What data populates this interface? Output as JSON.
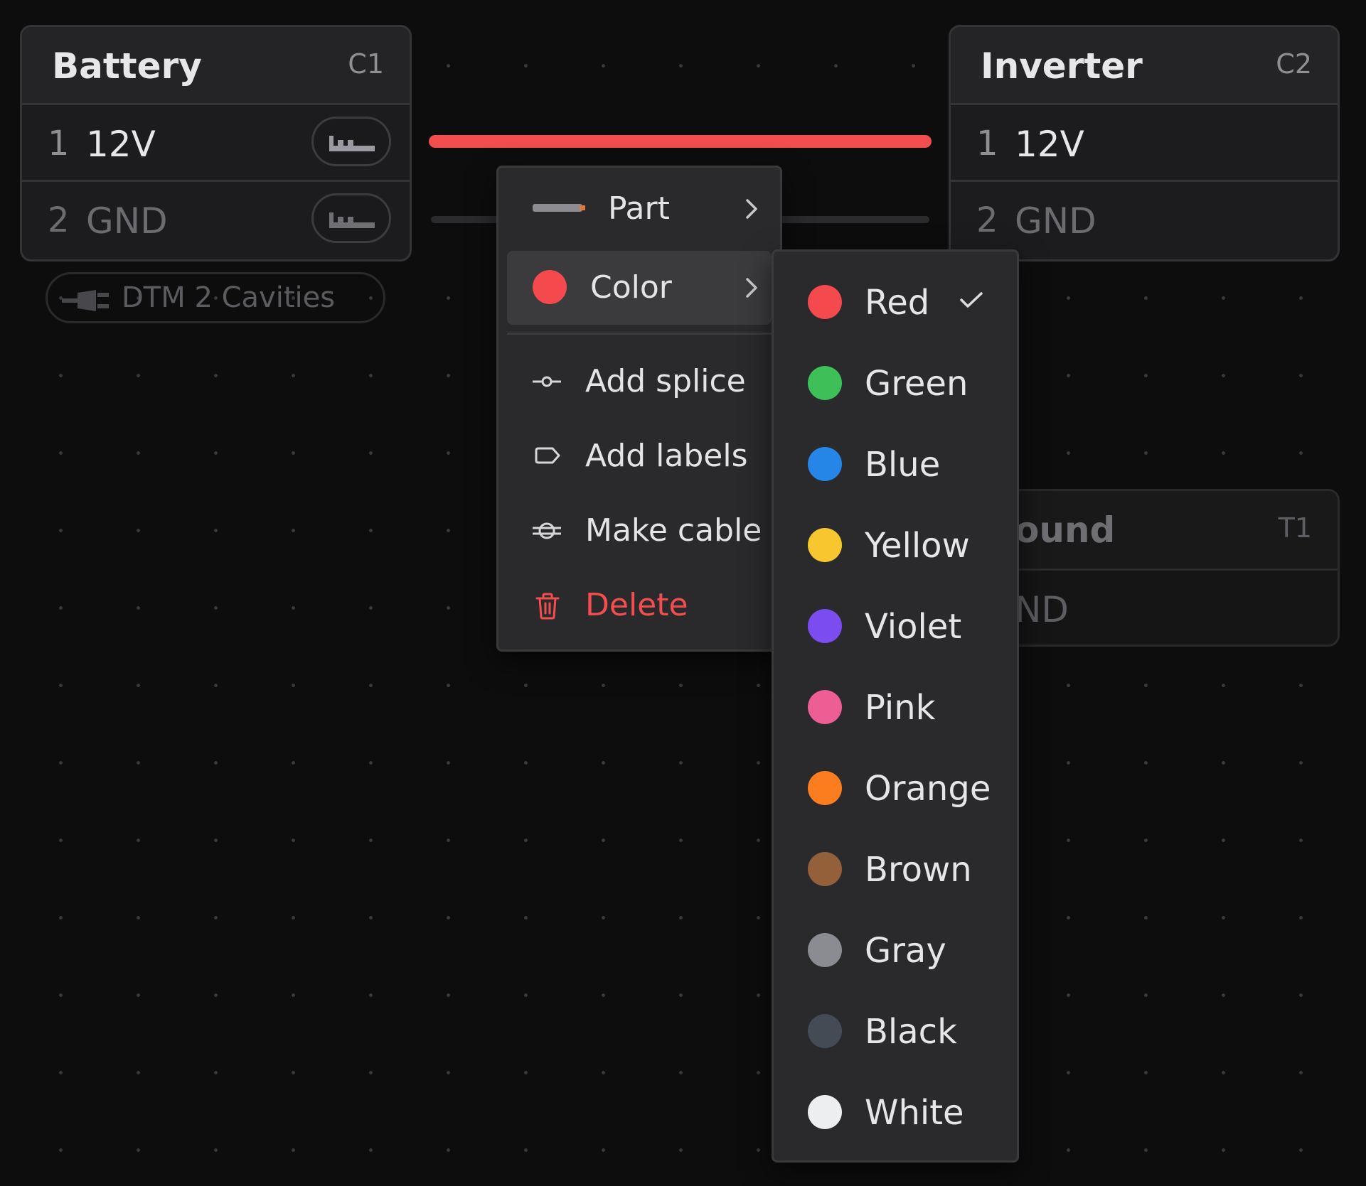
{
  "battery": {
    "title": "Battery",
    "id": "C1",
    "pins": [
      {
        "num": "1",
        "name": "12V"
      },
      {
        "num": "2",
        "name": "GND"
      }
    ],
    "connector": "DTM 2 Cavities"
  },
  "inverter": {
    "title": "Inverter",
    "id": "C2",
    "pins": [
      {
        "num": "1",
        "name": "12V"
      },
      {
        "num": "2",
        "name": "GND"
      }
    ]
  },
  "ground": {
    "title_partial": "ound",
    "id": "T1",
    "pin_partial": "ND"
  },
  "wires": {
    "selected_color": "#f24d4f"
  },
  "context_menu": {
    "items": [
      {
        "label": "Part"
      },
      {
        "label": "Color"
      },
      {
        "label": "Add splice"
      },
      {
        "label": "Add labels"
      },
      {
        "label": "Make cable"
      },
      {
        "label": "Delete"
      }
    ]
  },
  "color_menu": {
    "selected": "Red",
    "items": [
      {
        "label": "Red",
        "color": "#f4494d"
      },
      {
        "label": "Green",
        "color": "#3fbf57"
      },
      {
        "label": "Blue",
        "color": "#2586e8"
      },
      {
        "label": "Yellow",
        "color": "#f8c62f"
      },
      {
        "label": "Violet",
        "color": "#7b4cf0"
      },
      {
        "label": "Pink",
        "color": "#ec5e94"
      },
      {
        "label": "Orange",
        "color": "#fb7d1f"
      },
      {
        "label": "Brown",
        "color": "#94603a"
      },
      {
        "label": "Gray",
        "color": "#8a8c92"
      },
      {
        "label": "Black",
        "color": "#454b55"
      },
      {
        "label": "White",
        "color": "#eceef0"
      }
    ]
  }
}
